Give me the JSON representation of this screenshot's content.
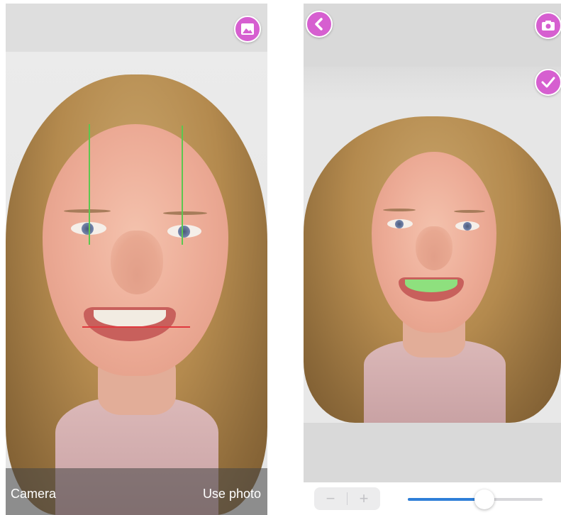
{
  "left_screen": {
    "bottom_bar": {
      "left_label": "Camera",
      "right_label": "Use photo"
    },
    "top_button_icon": "image-gallery-icon"
  },
  "right_screen": {
    "top_left_button_icon": "chevron-left-icon",
    "top_right_button_icon": "camera-icon",
    "confirm_button_icon": "checkmark-icon",
    "stepper": {
      "minus_label": "−",
      "plus_label": "+"
    },
    "slider_value": 0.57
  },
  "colors": {
    "accent": "#d65fd0",
    "slider_fill": "#2f7fd8",
    "guide_vertical": "#5cc74f",
    "guide_horizontal": "#e0393e",
    "teeth_highlight": "#8ee07e"
  }
}
